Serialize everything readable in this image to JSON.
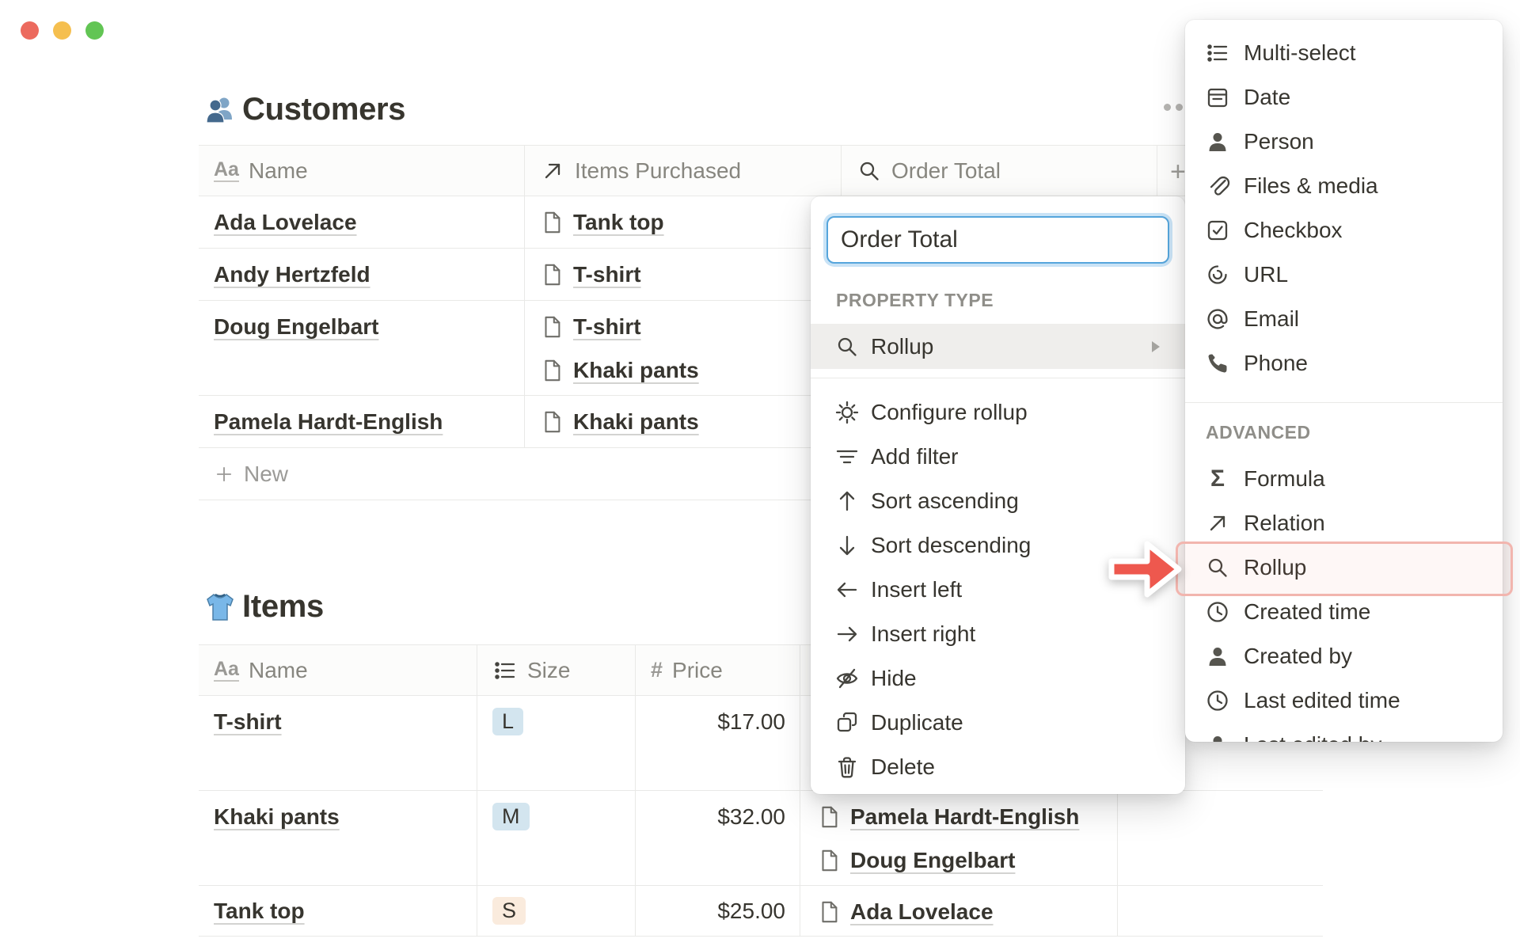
{
  "window": {
    "traffic_lights": [
      {
        "name": "close",
        "color": "#EC6A5E"
      },
      {
        "name": "minimize",
        "color": "#F5BF4F"
      },
      {
        "name": "zoom",
        "color": "#62C554"
      }
    ]
  },
  "customers": {
    "icon": "people-icon",
    "title": "Customers",
    "options_icon": "ellipsis-icon",
    "add_column_glyph": "+",
    "columns": [
      {
        "icon": "text-icon",
        "label": "Name"
      },
      {
        "icon": "relation-icon",
        "label": "Items Purchased"
      },
      {
        "icon": "search-icon",
        "label": "Order Total"
      }
    ],
    "rows": [
      {
        "name": "Ada Lovelace",
        "items": [
          "Tank top"
        ]
      },
      {
        "name": "Andy Hertzfeld",
        "items": [
          "T-shirt"
        ]
      },
      {
        "name": "Doug Engelbart",
        "items": [
          "T-shirt",
          "Khaki pants"
        ]
      },
      {
        "name": "Pamela Hardt-English",
        "items": [
          "Khaki pants"
        ]
      }
    ],
    "new_row_label": "New"
  },
  "items": {
    "icon": "tshirt-icon",
    "title": "Items",
    "columns": [
      {
        "icon": "text-icon",
        "label": "Name"
      },
      {
        "icon": "select-icon",
        "label": "Size"
      },
      {
        "icon": "number-icon",
        "label": "Price"
      }
    ],
    "rows": [
      {
        "name": "T-shirt",
        "size": "L",
        "size_color": "blue",
        "price": "$17.00",
        "purchasers": [],
        "lines": 2
      },
      {
        "name": "Khaki pants",
        "size": "M",
        "size_color": "blue",
        "price": "$32.00",
        "purchasers": [
          "Pamela Hardt-English",
          "Doug Engelbart"
        ],
        "lines": 2
      },
      {
        "name": "Tank top",
        "size": "S",
        "size_color": "orange",
        "price": "$25.00",
        "purchasers": [
          "Ada Lovelace"
        ],
        "lines": 1
      }
    ]
  },
  "property_menu": {
    "name_input_value": "Order Total",
    "section_label": "PROPERTY TYPE",
    "selected_type": {
      "icon": "rollup-icon",
      "label": "Rollup",
      "submenu_icon": "chevron-right-icon"
    },
    "actions": [
      {
        "icon": "gear-icon",
        "label": "Configure rollup"
      },
      {
        "icon": "filter-icon",
        "label": "Add filter"
      },
      {
        "icon": "arrow-up-icon",
        "label": "Sort ascending"
      },
      {
        "icon": "arrow-down-icon",
        "label": "Sort descending"
      },
      {
        "icon": "arrow-left-icon",
        "label": "Insert left"
      },
      {
        "icon": "arrow-right-icon",
        "label": "Insert right"
      },
      {
        "icon": "eye-off-icon",
        "label": "Hide"
      },
      {
        "icon": "duplicate-icon",
        "label": "Duplicate"
      },
      {
        "icon": "trash-icon",
        "label": "Delete"
      }
    ]
  },
  "type_menu": {
    "basic": [
      {
        "icon": "multi-select-icon",
        "label": "Multi-select"
      },
      {
        "icon": "date-icon",
        "label": "Date"
      },
      {
        "icon": "person-icon",
        "label": "Person"
      },
      {
        "icon": "files-icon",
        "label": "Files & media"
      },
      {
        "icon": "checkbox-icon",
        "label": "Checkbox"
      },
      {
        "icon": "url-icon",
        "label": "URL"
      },
      {
        "icon": "email-icon",
        "label": "Email"
      },
      {
        "icon": "phone-icon",
        "label": "Phone"
      }
    ],
    "advanced_label": "ADVANCED",
    "advanced": [
      {
        "icon": "formula-icon",
        "label": "Formula"
      },
      {
        "icon": "relation-icon",
        "label": "Relation"
      },
      {
        "icon": "rollup-icon",
        "label": "Rollup",
        "highlighted": true
      },
      {
        "icon": "clock-icon",
        "label": "Created time"
      },
      {
        "icon": "person-icon",
        "label": "Created by"
      },
      {
        "icon": "clock-icon",
        "label": "Last edited time"
      },
      {
        "icon": "person-icon",
        "label": "Last edited by",
        "clipped": true
      }
    ]
  },
  "annotation": {
    "arrow_color": "#EE584E",
    "highlight_border_color": "#F2B5AE",
    "highlight_fill_color": "rgba(240,95,85,0.05)"
  },
  "colors": {
    "text_primary": "#37352F",
    "text_secondary": "#87867F",
    "divider": "#E9E9E7",
    "input_focus_blue": "#55A5DC",
    "tag_blue": "#D3E5EF",
    "tag_orange": "#FAEBDD",
    "selected_row_bg": "#EFEEEC"
  }
}
